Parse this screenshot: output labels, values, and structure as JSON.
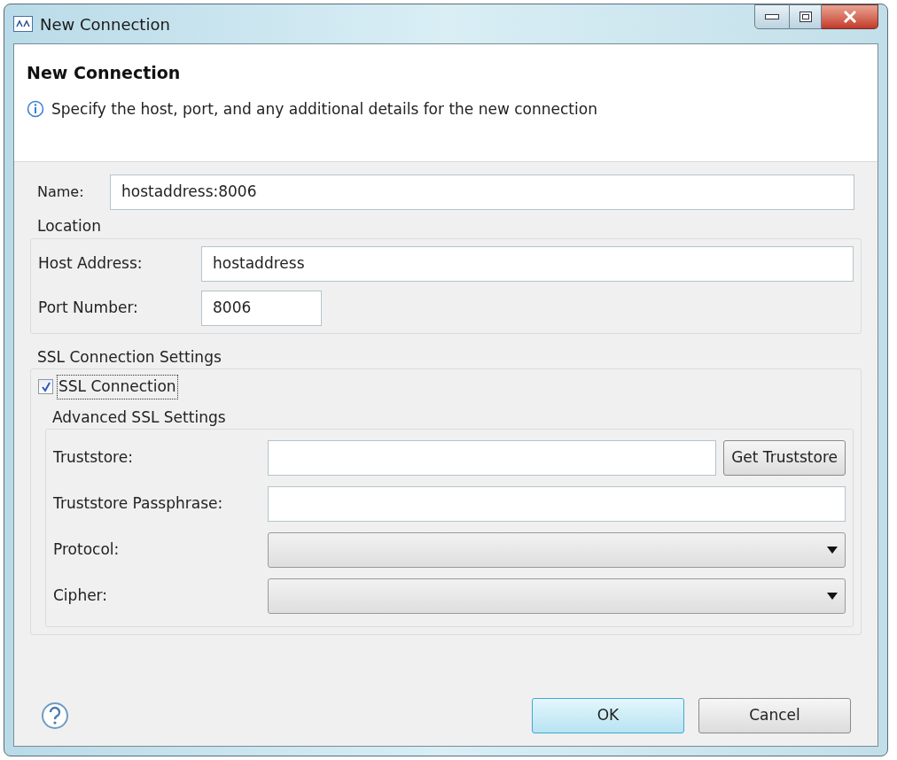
{
  "window": {
    "title": "New Connection"
  },
  "header": {
    "title": "New Connection",
    "message": "Specify the host, port, and any additional details for the new connection"
  },
  "name_field": {
    "label": "Name:",
    "value": "hostaddress:8006"
  },
  "location": {
    "title": "Location",
    "fields": [
      {
        "label": "Host Address:",
        "value": "hostaddress"
      },
      {
        "label": "Port Number:",
        "value": "8006"
      }
    ]
  },
  "ssl": {
    "title": "SSL Connection Settings",
    "checkbox": {
      "label": "SSL Connection",
      "checked": true
    },
    "advanced": {
      "title": "Advanced SSL Settings",
      "rows": [
        {
          "kind": "text_button",
          "label": "Truststore:",
          "button": "Get Truststore"
        },
        {
          "kind": "text",
          "label": "Truststore Passphrase:"
        },
        {
          "kind": "dropdown",
          "label": "Protocol:"
        },
        {
          "kind": "dropdown",
          "label": "Cipher:"
        }
      ]
    }
  },
  "buttons": [
    {
      "label": "OK",
      "default": true
    },
    {
      "label": "Cancel",
      "default": false
    }
  ]
}
